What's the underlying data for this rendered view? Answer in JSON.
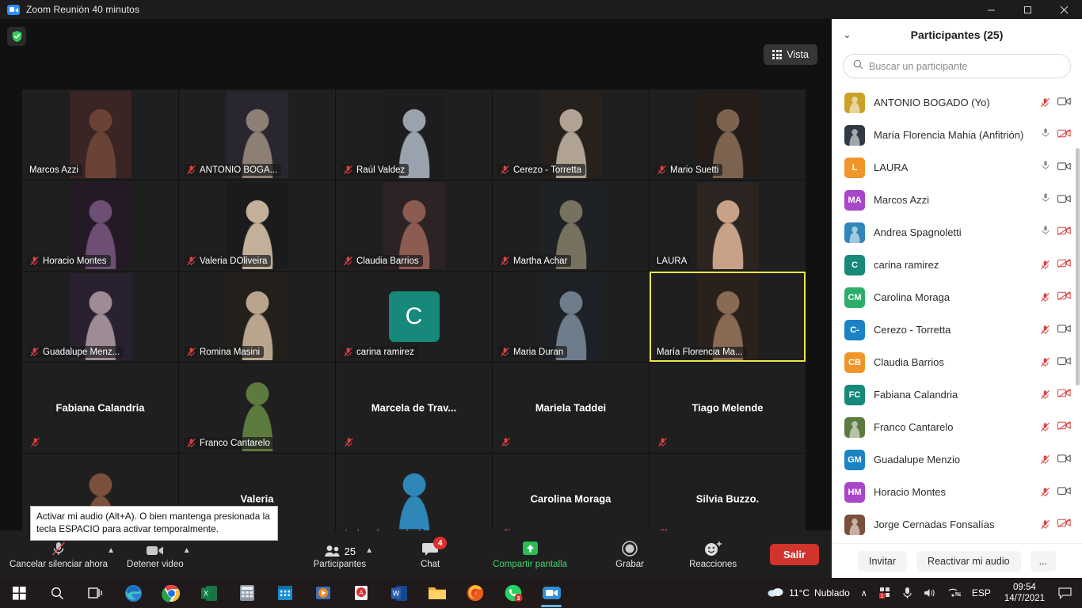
{
  "window": {
    "title": "Zoom Reunión 40 minutos",
    "app_icon": "zoom-camera-icon",
    "minimize": "minimize-icon",
    "maximize": "maximize-icon",
    "close": "close-icon"
  },
  "stage": {
    "shield_icon": "security-shield-icon",
    "view_button": "Vista",
    "view_icon": "grid-view-icon"
  },
  "tiles": [
    {
      "name": "Marcos Azzi",
      "muted": false,
      "layout": "bar",
      "video": true,
      "bg": "#3a2424",
      "fg": "#6b4336"
    },
    {
      "name": "ANTONIO BOGA...",
      "muted": true,
      "layout": "bar",
      "video": true,
      "bg": "#2a2630",
      "fg": "#8d7f74"
    },
    {
      "name": "Raúl Valdez",
      "muted": true,
      "layout": "bar",
      "video": true,
      "bg": "#1d1d1f",
      "fg": "#9aa3ad"
    },
    {
      "name": "Cerezo - Torretta",
      "muted": true,
      "layout": "bar",
      "video": true,
      "bg": "#26211c",
      "fg": "#b1a393"
    },
    {
      "name": "Mario Suetti",
      "muted": true,
      "layout": "bar",
      "video": true,
      "bg": "#241c18",
      "fg": "#7b6350"
    },
    {
      "name": "Horacio  Montes",
      "muted": true,
      "layout": "bar",
      "video": true,
      "bg": "#241a26",
      "fg": "#6e4f74"
    },
    {
      "name": "Valeria DOliveira",
      "muted": true,
      "layout": "bar",
      "video": true,
      "bg": "#1b1b1d",
      "fg": "#c3b09a"
    },
    {
      "name": "Claudia Barrios",
      "muted": true,
      "layout": "bar",
      "video": true,
      "bg": "#2d2224",
      "fg": "#8c5b52"
    },
    {
      "name": "Martha Achar",
      "muted": true,
      "layout": "bar",
      "video": true,
      "bg": "#1f2224",
      "fg": "#77715f"
    },
    {
      "name": "LAURA",
      "muted": false,
      "layout": "bar",
      "video": true,
      "bg": "#2b2420",
      "fg": "#c8a186"
    },
    {
      "name": "Guadalupe Menz...",
      "muted": true,
      "layout": "bar",
      "video": true,
      "bg": "#2a2130",
      "fg": "#9e8b96"
    },
    {
      "name": "Romina Masini",
      "muted": true,
      "layout": "bar",
      "video": true,
      "bg": "#23201c",
      "fg": "#b9a48e"
    },
    {
      "name": "carina ramirez",
      "muted": true,
      "layout": "initial",
      "initial": "C",
      "avatar_color": "#16897a",
      "video": false
    },
    {
      "name": "Maria Duran",
      "muted": true,
      "layout": "bar",
      "video": true,
      "bg": "#1d2024",
      "fg": "#6e7d8c"
    },
    {
      "name": "María Florencia Ma...",
      "muted": false,
      "layout": "bar",
      "video": true,
      "active": true,
      "bg": "#2a211c",
      "fg": "#8a6a52"
    },
    {
      "name": "Fabiana Calandria",
      "muted": true,
      "layout": "center",
      "video": false
    },
    {
      "name": "Franco Cantarelo",
      "muted": true,
      "layout": "bar",
      "video": true,
      "bg": "#1f1f1f",
      "fg": "#5d7a3f"
    },
    {
      "name": "Marcela  de Trav...",
      "muted": true,
      "layout": "center",
      "video": false
    },
    {
      "name": "Mariela Taddei",
      "muted": true,
      "layout": "center",
      "video": false
    },
    {
      "name": "Tiago Melende",
      "muted": true,
      "layout": "center",
      "video": false
    },
    {
      "name": "Jorge Cernadas ...",
      "muted": true,
      "layout": "bar",
      "video": true,
      "bg": "#1f1f1f",
      "fg": "#7c4f3c"
    },
    {
      "name": "Valeria",
      "muted": true,
      "layout": "center",
      "video": false
    },
    {
      "name": "Andrea Spagnoletti",
      "muted": false,
      "layout": "bar",
      "video": true,
      "bg": "#1f1f1f",
      "fg": "#2f86b8"
    },
    {
      "name": "Carolina Moraga",
      "muted": true,
      "layout": "center",
      "video": false
    },
    {
      "name": "Silvia Buzzo.",
      "muted": true,
      "layout": "center",
      "video": false
    }
  ],
  "toolbar": {
    "audio_label": "Cancelar silenciar ahora",
    "audio_icon": "mic-off-icon",
    "video_label": "Detener video",
    "video_icon": "camera-icon",
    "participants_label": "Participantes",
    "participants_count": "25",
    "participants_icon": "people-icon",
    "chat_label": "Chat",
    "chat_icon": "chat-bubble-icon",
    "chat_badge": "4",
    "share_label": "Compartir pantalla",
    "share_icon": "share-screen-icon",
    "record_label": "Grabar",
    "record_icon": "record-circle-icon",
    "reactions_label": "Reacciones",
    "reactions_icon": "smiley-plus-icon",
    "leave_label": "Salir",
    "tooltip": "Activar mi audio (Alt+A). O bien mantenga presionada la tecla ESPACIO para activar temporalmente."
  },
  "panel": {
    "collapse_icon": "chevron-down-icon",
    "title": "Participantes (25)",
    "search_placeholder": "Buscar un participante",
    "search_value": "",
    "search_icon": "search-icon",
    "invite_label": "Invitar",
    "unmute_label": "Reactivar mi audio",
    "more_label": "...",
    "participants": [
      {
        "name": "ANTONIO BOGADO (Yo)",
        "avatar_type": "photo",
        "avatar_color": "#c9a227",
        "initials": "",
        "mic": "muted",
        "cam": "on"
      },
      {
        "name": "María Florencia Mahia (Anfitrión)",
        "avatar_type": "photo",
        "avatar_color": "#2f3a44",
        "initials": "",
        "mic": "on",
        "cam": "off"
      },
      {
        "name": "LAURA",
        "avatar_type": "initials",
        "avatar_color": "#f0952a",
        "initials": "L",
        "mic": "on",
        "cam": "on"
      },
      {
        "name": "Marcos Azzi",
        "avatar_type": "initials",
        "avatar_color": "#a847c9",
        "initials": "MA",
        "mic": "on",
        "cam": "on"
      },
      {
        "name": "Andrea Spagnoletti",
        "avatar_type": "photo",
        "avatar_color": "#2f86b8",
        "initials": "",
        "mic": "on",
        "cam": "off"
      },
      {
        "name": "carina ramirez",
        "avatar_type": "initials",
        "avatar_color": "#16897a",
        "initials": "C",
        "mic": "muted",
        "cam": "off"
      },
      {
        "name": "Carolina Moraga",
        "avatar_type": "initials",
        "avatar_color": "#2fae6b",
        "initials": "CM",
        "mic": "muted",
        "cam": "off"
      },
      {
        "name": "Cerezo - Torretta",
        "avatar_type": "initials",
        "avatar_color": "#1b83c4",
        "initials": "C-",
        "mic": "muted",
        "cam": "on"
      },
      {
        "name": "Claudia Barrios",
        "avatar_type": "initials",
        "avatar_color": "#f0952a",
        "initials": "CB",
        "mic": "muted",
        "cam": "on"
      },
      {
        "name": "Fabiana Calandria",
        "avatar_type": "initials",
        "avatar_color": "#16897a",
        "initials": "FC",
        "mic": "muted",
        "cam": "off"
      },
      {
        "name": "Franco Cantarelo",
        "avatar_type": "photo",
        "avatar_color": "#5d7a3f",
        "initials": "",
        "mic": "muted",
        "cam": "off"
      },
      {
        "name": "Guadalupe Menzio",
        "avatar_type": "initials",
        "avatar_color": "#1b83c4",
        "initials": "GM",
        "mic": "muted",
        "cam": "on"
      },
      {
        "name": "Horacio  Montes",
        "avatar_type": "initials",
        "avatar_color": "#a847c9",
        "initials": "HM",
        "mic": "muted",
        "cam": "on"
      },
      {
        "name": "Jorge Cernadas Fonsalías",
        "avatar_type": "photo",
        "avatar_color": "#7c4f3c",
        "initials": "",
        "mic": "muted",
        "cam": "off"
      }
    ]
  },
  "taskbar": {
    "start_icon": "windows-start-icon",
    "search_icon": "search-icon",
    "taskview_icon": "task-view-icon",
    "apps": [
      {
        "icon": "edge-icon"
      },
      {
        "icon": "chrome-icon"
      },
      {
        "icon": "excel-icon"
      },
      {
        "icon": "calculator-icon"
      },
      {
        "icon": "calendar-icon"
      },
      {
        "icon": "media-player-icon"
      },
      {
        "icon": "pdf-icon"
      },
      {
        "icon": "word-icon"
      },
      {
        "icon": "file-explorer-icon"
      },
      {
        "icon": "firefox-icon"
      },
      {
        "icon": "whatsapp-icon",
        "badge": "3"
      },
      {
        "icon": "zoom-icon",
        "running": true
      }
    ],
    "weather_temp": "11°C",
    "weather_desc": "Nublado",
    "weather_icon": "cloud-icon",
    "tray_up_icon": "chevron-up-icon",
    "tray_icons": [
      "notification-red-icon",
      "microphone-icon",
      "volume-icon",
      "network-icon"
    ],
    "language": "ESP",
    "time": "09:54",
    "date": "14/7/2021",
    "action_center_icon": "action-center-icon"
  }
}
